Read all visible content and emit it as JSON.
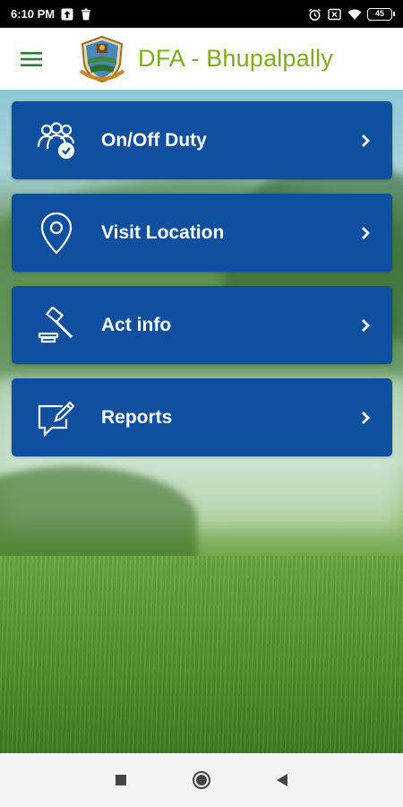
{
  "status_bar": {
    "time": "6:10 PM",
    "battery": "45"
  },
  "app_bar": {
    "title": "DFA - Bhupalpally"
  },
  "menu": [
    {
      "label": "On/Off Duty",
      "icon": "users-check-icon"
    },
    {
      "label": "Visit Location",
      "icon": "location-pin-icon"
    },
    {
      "label": "Act info",
      "icon": "gavel-icon"
    },
    {
      "label": "Reports",
      "icon": "edit-message-icon"
    }
  ],
  "colors": {
    "card": "#0f4fa0",
    "title": "#7cac1a",
    "menu_icon": "#2e7d32"
  }
}
